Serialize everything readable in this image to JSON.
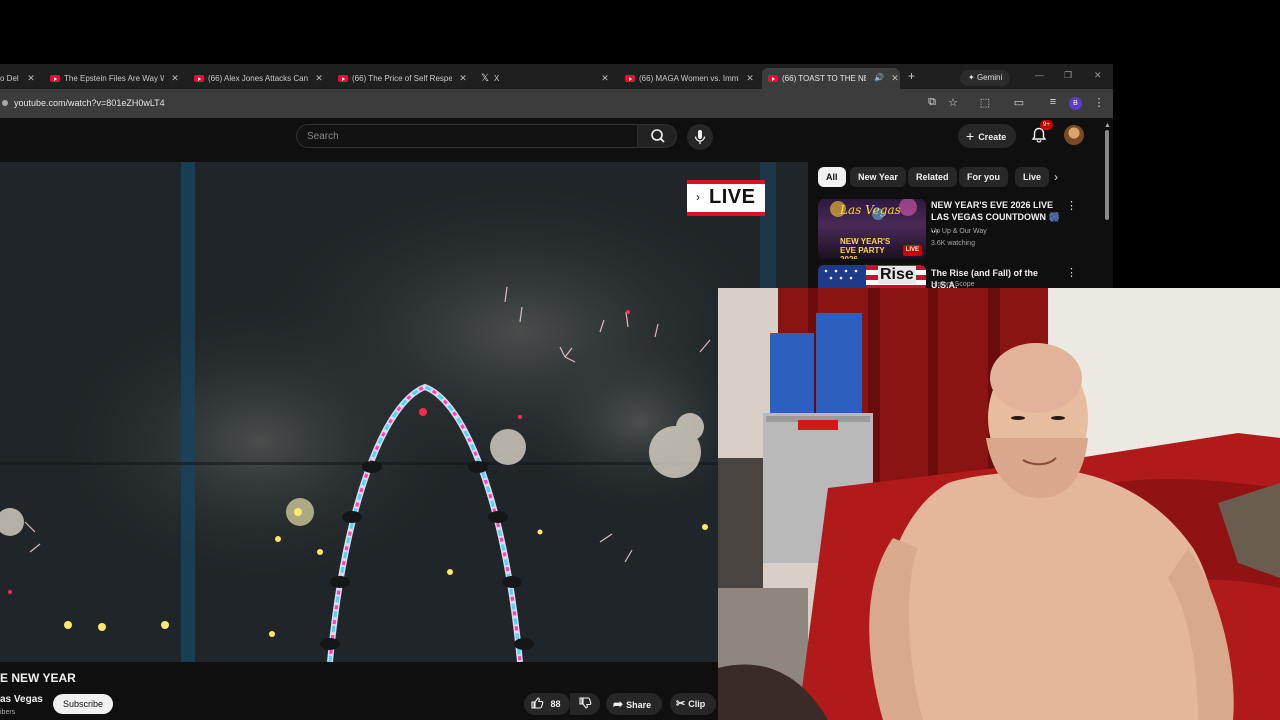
{
  "tabs": [
    {
      "title": "o Del"
    },
    {
      "title": "The Epstein Files Are Way Wo"
    },
    {
      "title": "(66) Alex Jones Attacks Cand"
    },
    {
      "title": "(66) The Price of Self Respect"
    },
    {
      "title": "X"
    },
    {
      "title": "(66) MAGA Women vs. Immi"
    },
    {
      "title": "(66) TOAST TO THE NEW"
    }
  ],
  "gemini_label": "Gemini",
  "profile_letter": "B",
  "address": "youtube.com/watch?v=801eZH0wLT4",
  "search": {
    "placeholder": "Search"
  },
  "header": {
    "create_label": "Create",
    "notif_badge": "9+"
  },
  "player": {
    "live_badge": "LIVE"
  },
  "video": {
    "title": "E NEW YEAR",
    "channel": "as Vegas",
    "subscribers": "ibers",
    "subscribe_label": "Subscribe",
    "likes": "88",
    "share_label": "Share",
    "clip_label": "Clip"
  },
  "chips": [
    "All",
    "New Year",
    "Related",
    "For you",
    "Live"
  ],
  "recommendations": [
    {
      "title": "NEW YEAR'S EVE 2026 LIVE LAS VEGAS COUNTDOWN 🎆 ...",
      "channel": "Up Up & Our Way",
      "meta": "3.6K watching",
      "thumb_text_1": "Las Vegas",
      "thumb_text_2": "NEW YEAR'S EVE PARTY 2026",
      "thumb_badge": "LIVE"
    },
    {
      "title": "The Rise (and Fall) of the U.S.A.",
      "channel": "History Scope",
      "thumb_text_1": "Rise"
    }
  ],
  "colors": {
    "youtube_red": "#ff0033",
    "bg": "#0f0f0f",
    "chip": "#272727",
    "live_red": "#e0101e"
  }
}
